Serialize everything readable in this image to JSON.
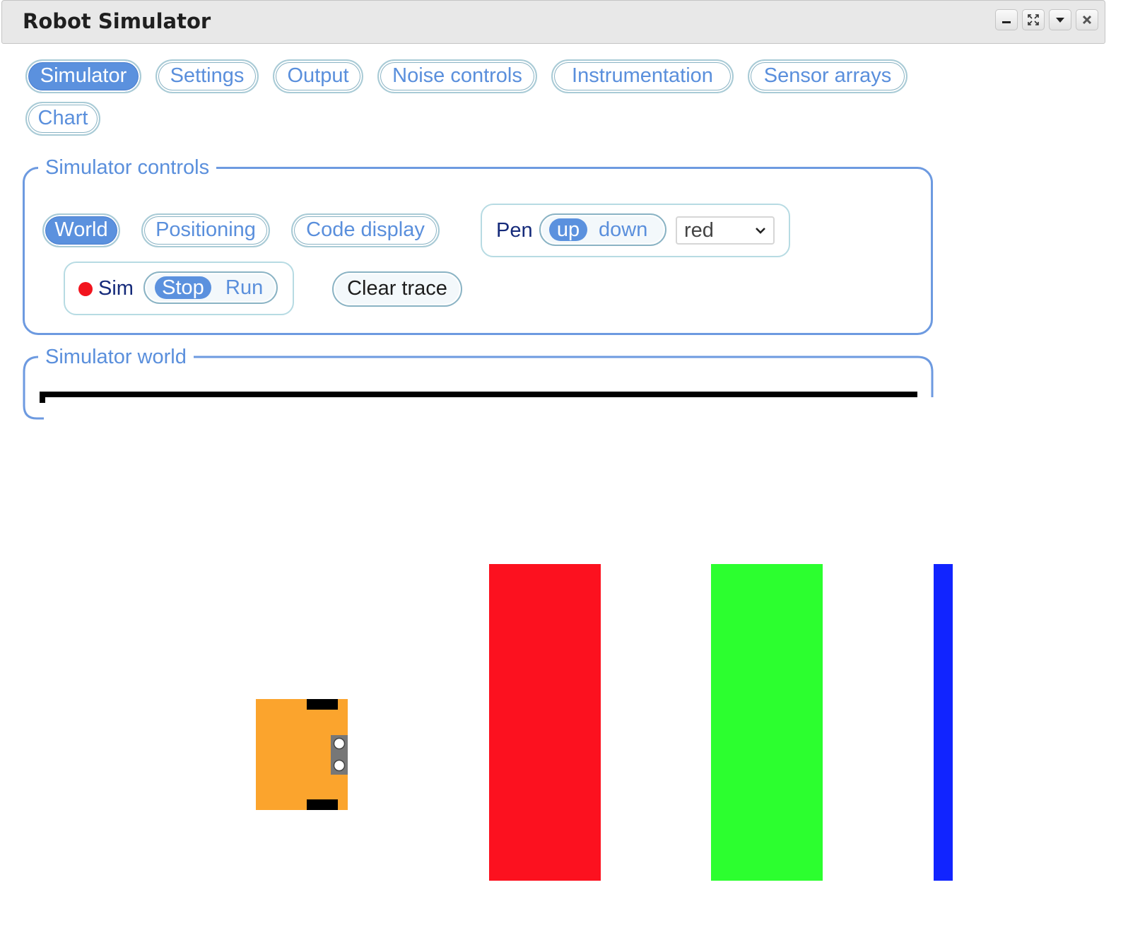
{
  "window": {
    "title": "Robot Simulator",
    "controls": [
      "minimize-icon",
      "expand-icon",
      "dropdown-icon",
      "close-icon"
    ]
  },
  "tabs": [
    {
      "label": "Simulator",
      "active": true
    },
    {
      "label": "Settings",
      "active": false
    },
    {
      "label": "Output",
      "active": false
    },
    {
      "label": "Noise controls",
      "active": false
    },
    {
      "label": "Instrumentation",
      "active": false
    },
    {
      "label": "Sensor arrays",
      "active": false
    },
    {
      "label": "Chart",
      "active": false
    }
  ],
  "controls": {
    "legend": "Simulator controls",
    "subtabs": [
      {
        "label": "World",
        "active": true
      },
      {
        "label": "Positioning",
        "active": false
      },
      {
        "label": "Code display",
        "active": false
      }
    ],
    "pen": {
      "label": "Pen",
      "options": [
        "up",
        "down"
      ],
      "selected": "up",
      "color": "red"
    },
    "sim": {
      "label": "Sim",
      "indicator_color": "#f2141e",
      "options": [
        "Stop",
        "Run"
      ],
      "selected": "Stop"
    },
    "clear_trace": "Clear trace"
  },
  "world": {
    "legend": "Simulator world",
    "colors": {
      "robot_body": "#fba42d",
      "red_block": "#fc111f",
      "green_block": "#2cff2f",
      "blue_block": "#1124ff"
    }
  }
}
